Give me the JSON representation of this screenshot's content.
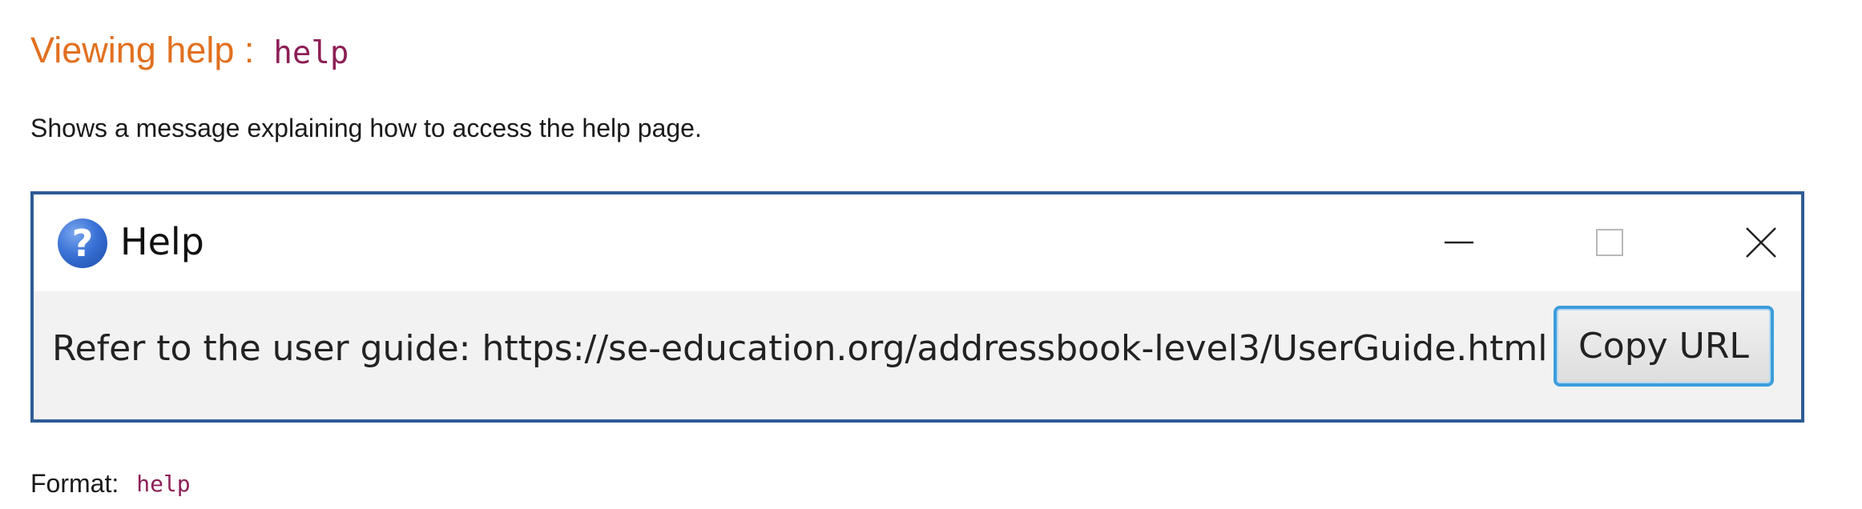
{
  "heading": {
    "text": "Viewing help :",
    "command": "help"
  },
  "description": "Shows a message explaining how to access the help page.",
  "help_window": {
    "title": "Help",
    "icon": "question-mark-icon",
    "controls": [
      "minimize-icon",
      "maximize-icon",
      "close-icon"
    ],
    "message": "Refer to the user guide: https://se-education.org/addressbook-level3/UserGuide.html",
    "copy_button_label": "Copy URL",
    "border_color": "#2e5c96",
    "button_focus_color": "#3b9ddd"
  },
  "format": {
    "label": "Format:",
    "command": "help"
  },
  "colors": {
    "heading": "#e1701f",
    "code": "#8c1f55"
  }
}
